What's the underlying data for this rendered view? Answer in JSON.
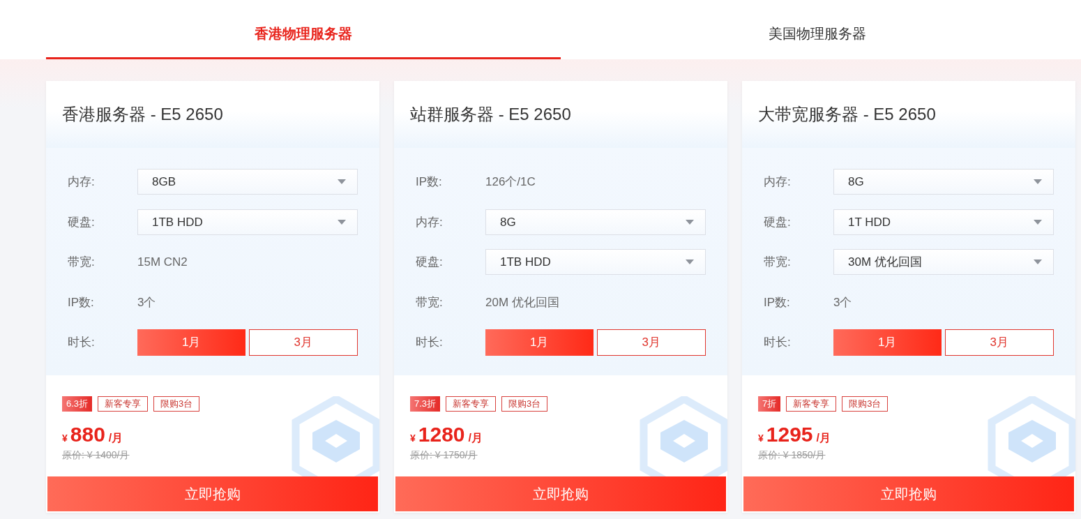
{
  "tabs": [
    {
      "label": "香港物理服务器",
      "selected": true
    },
    {
      "label": "美国物理服务器",
      "selected": false
    }
  ],
  "cards": [
    {
      "title": "香港服务器 - E5 2650",
      "options": [
        {
          "kind": "select",
          "label": "内存:",
          "value": "8GB"
        },
        {
          "kind": "select",
          "label": "硬盘:",
          "value": "1TB HDD"
        },
        {
          "kind": "text",
          "label": "带宽:",
          "value": "15M CN2"
        },
        {
          "kind": "text",
          "label": "IP数:",
          "value": "3个"
        },
        {
          "kind": "choice",
          "label": "时长:",
          "choices": [
            {
              "label": "1月",
              "selected": true
            },
            {
              "label": "3月",
              "selected": false
            }
          ]
        }
      ],
      "tags": [
        {
          "kind": "discount",
          "label": "6.3折"
        },
        {
          "kind": "outline",
          "label": "新客专享"
        },
        {
          "kind": "outline",
          "label": "限购3台"
        }
      ],
      "currency": "¥",
      "price": "880",
      "unit": "/月",
      "original_price": "原价: ¥ 1400/月",
      "buy_button": "立即抢购"
    },
    {
      "title": "站群服务器 - E5 2650",
      "options": [
        {
          "kind": "text",
          "label": "IP数:",
          "value": "126个/1C"
        },
        {
          "kind": "select",
          "label": "内存:",
          "value": "8G"
        },
        {
          "kind": "select",
          "label": "硬盘:",
          "value": "1TB HDD"
        },
        {
          "kind": "text",
          "label": "带宽:",
          "value": "20M 优化回国"
        },
        {
          "kind": "choice",
          "label": "时长:",
          "choices": [
            {
              "label": "1月",
              "selected": true
            },
            {
              "label": "3月",
              "selected": false
            }
          ]
        }
      ],
      "tags": [
        {
          "kind": "discount",
          "label": "7.3折"
        },
        {
          "kind": "outline",
          "label": "新客专享"
        },
        {
          "kind": "outline",
          "label": "限购3台"
        }
      ],
      "currency": "¥",
      "price": "1280",
      "unit": "/月",
      "original_price": "原价: ¥ 1750/月",
      "buy_button": "立即抢购"
    },
    {
      "title": "大带宽服务器 - E5 2650",
      "options": [
        {
          "kind": "select",
          "label": "内存:",
          "value": "8G"
        },
        {
          "kind": "select",
          "label": "硬盘:",
          "value": "1T HDD"
        },
        {
          "kind": "select",
          "label": "带宽:",
          "value": "30M 优化回国"
        },
        {
          "kind": "text",
          "label": "IP数:",
          "value": "3个"
        },
        {
          "kind": "choice",
          "label": "时长:",
          "choices": [
            {
              "label": "1月",
              "selected": true
            },
            {
              "label": "3月",
              "selected": false
            }
          ]
        }
      ],
      "tags": [
        {
          "kind": "discount",
          "label": "7折"
        },
        {
          "kind": "outline",
          "label": "新客专享"
        },
        {
          "kind": "outline",
          "label": "限购3台"
        }
      ],
      "currency": "¥",
      "price": "1295",
      "unit": "/月",
      "original_price": "原价: ¥ 1850/月",
      "buy_button": "立即抢购"
    }
  ]
}
